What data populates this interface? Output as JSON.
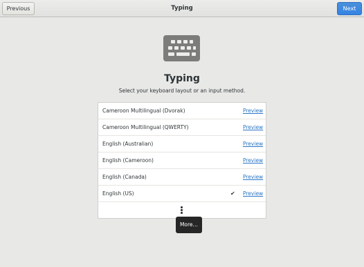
{
  "header": {
    "title": "Typing",
    "previous_label": "Previous",
    "next_label": "Next"
  },
  "icon": "keyboard-icon",
  "page": {
    "title": "Typing",
    "subtitle": "Select your keyboard layout or an input method."
  },
  "layouts": [
    {
      "name": "Cameroon Multilingual (Dvorak)",
      "preview_label": "Preview",
      "selected": false
    },
    {
      "name": "Cameroon Multilingual (QWERTY)",
      "preview_label": "Preview",
      "selected": false
    },
    {
      "name": "English (Australian)",
      "preview_label": "Preview",
      "selected": false
    },
    {
      "name": "English (Cameroon)",
      "preview_label": "Preview",
      "selected": false
    },
    {
      "name": "English (Canada)",
      "preview_label": "Preview",
      "selected": false
    },
    {
      "name": "English (US)",
      "preview_label": "Preview",
      "selected": true,
      "check": "✔"
    }
  ],
  "more_tooltip": "More…",
  "colors": {
    "accent": "#3584e4",
    "link": "#2a76c6",
    "background": "#e8e8e7"
  }
}
